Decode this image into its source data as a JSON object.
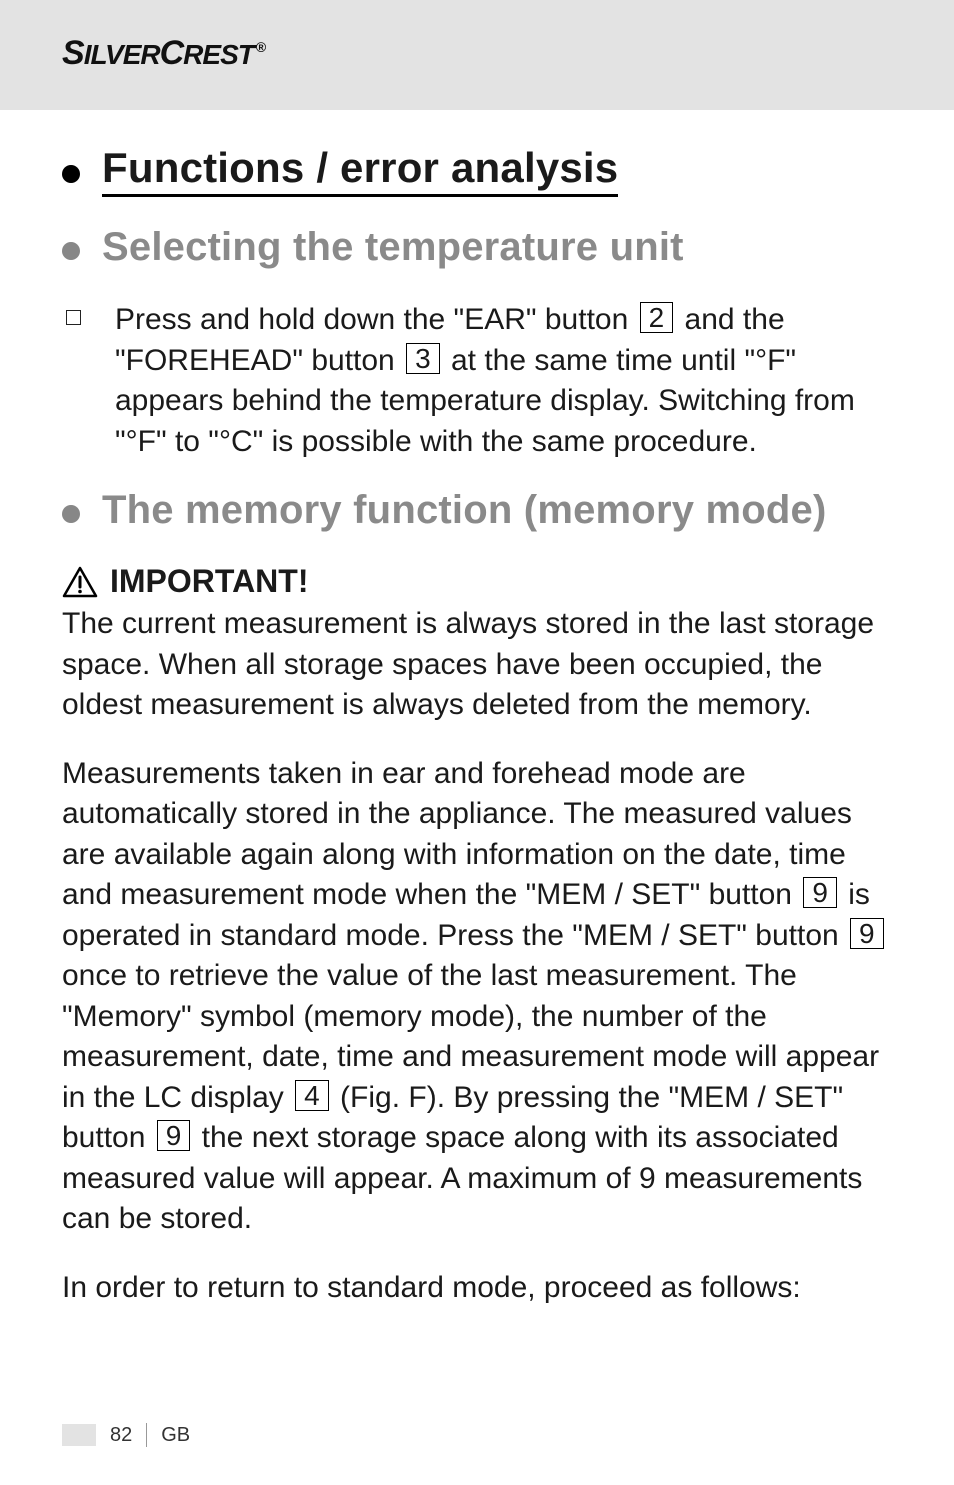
{
  "brand": "SILVERCREST®",
  "headings": {
    "h1": "Functions / error analysis",
    "h2a": "Selecting the temperature unit",
    "h2b": "The memory function (memory mode)"
  },
  "step1": {
    "t1": "Press and hold down the \"EAR\" button ",
    "ref1": "2",
    "t2": " and the \"FOREHEAD\" button ",
    "ref2": "3",
    "t3": " at the same time until \"°F\" appears behind the temperature display. Switching from \"°F\" to \"°C\" is possible with the same procedure."
  },
  "important_label": "IMPORTANT!",
  "important_body": "The current measurement is always stored in the last storage space. When all storage spaces have been occupied, the oldest measurement is always deleted from the memory.",
  "mem": {
    "t1": "Measurements taken in ear and forehead mode are automatically stored in the appliance. The measured values are available again along with information on the date, time and measurement mode when the \"MEM / SET\" button ",
    "ref1": "9",
    "t2": " is operated in standard mode. Press the \"MEM / SET\" button ",
    "ref2": "9",
    "t3": " once to retrieve the value of the last measurement. The \"Memory\" symbol (memory mode), the number of the measurement, date, time and measurement mode will appear in the LC display ",
    "ref3": "4",
    "t4": " (Fig. F). By pressing the \"MEM / SET\" button ",
    "ref4": "9",
    "t5": " the next storage space along with its associated measured value will appear. A maximum of 9 measurements can be stored."
  },
  "return_line": "In order to return to standard mode, proceed as follows:",
  "footer": {
    "page": "82",
    "region": "GB"
  }
}
